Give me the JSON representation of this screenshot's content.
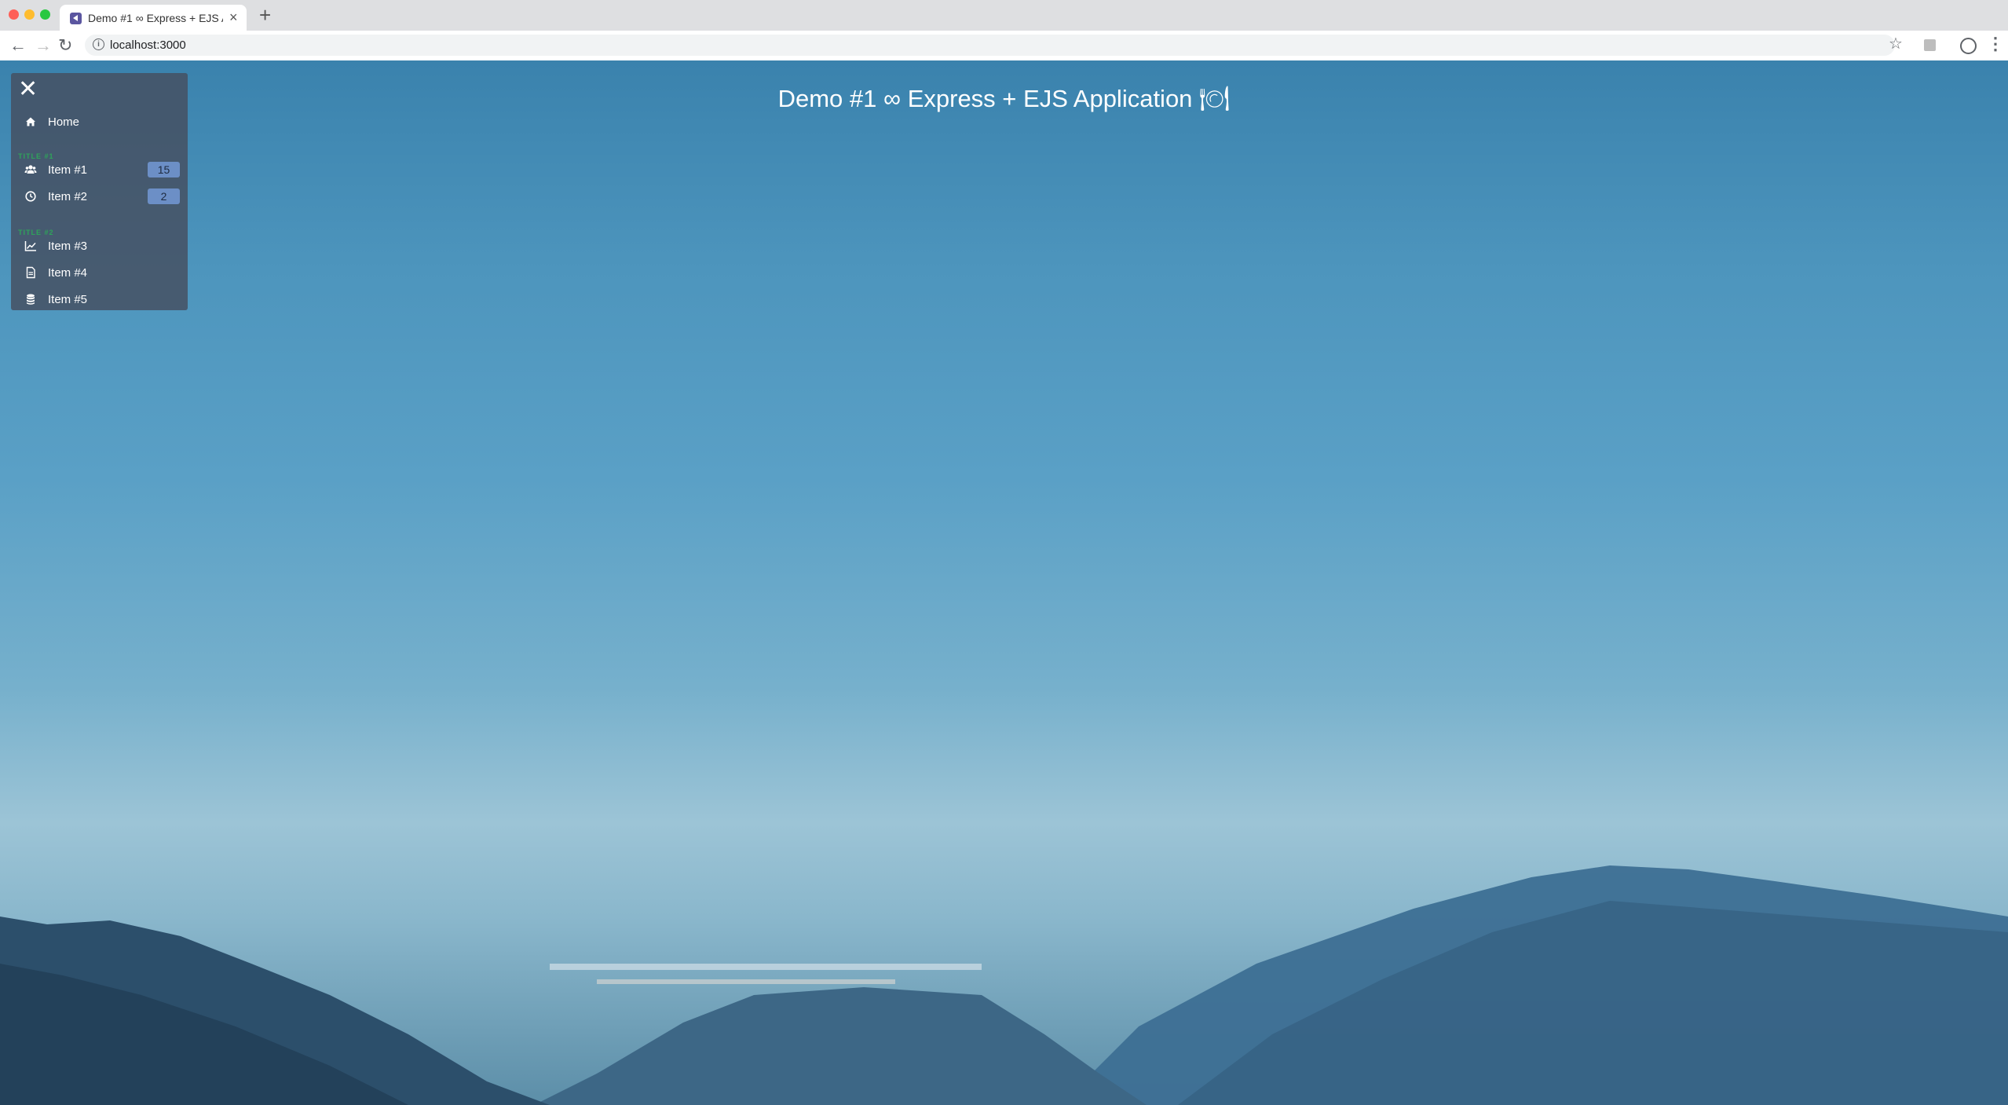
{
  "browser": {
    "tab_title": "Demo #1 ∞ Express + EJS Application",
    "url": "localhost:3000"
  },
  "page": {
    "title": "Demo #1 ∞ Express + EJS Application 🍽"
  },
  "sidebar": {
    "home": {
      "label": "Home",
      "icon": "home-icon"
    },
    "sections": [
      {
        "title": "TITLE #1",
        "items": [
          {
            "label": "Item #1",
            "icon": "users-icon",
            "badge": "15"
          },
          {
            "label": "Item #2",
            "icon": "clock-icon",
            "badge": "2"
          }
        ]
      },
      {
        "title": "TITLE #2",
        "items": [
          {
            "label": "Item #3",
            "icon": "chart-line-icon"
          },
          {
            "label": "Item #4",
            "icon": "document-icon"
          },
          {
            "label": "Item #5",
            "icon": "database-icon"
          }
        ]
      }
    ]
  },
  "colors": {
    "sidebar_bg": "#464e5f",
    "section_title": "#2ea35a",
    "badge_bg": "#6c8fc6",
    "sky_top": "#3a82ad",
    "sky_mid": "#76b0cc"
  }
}
